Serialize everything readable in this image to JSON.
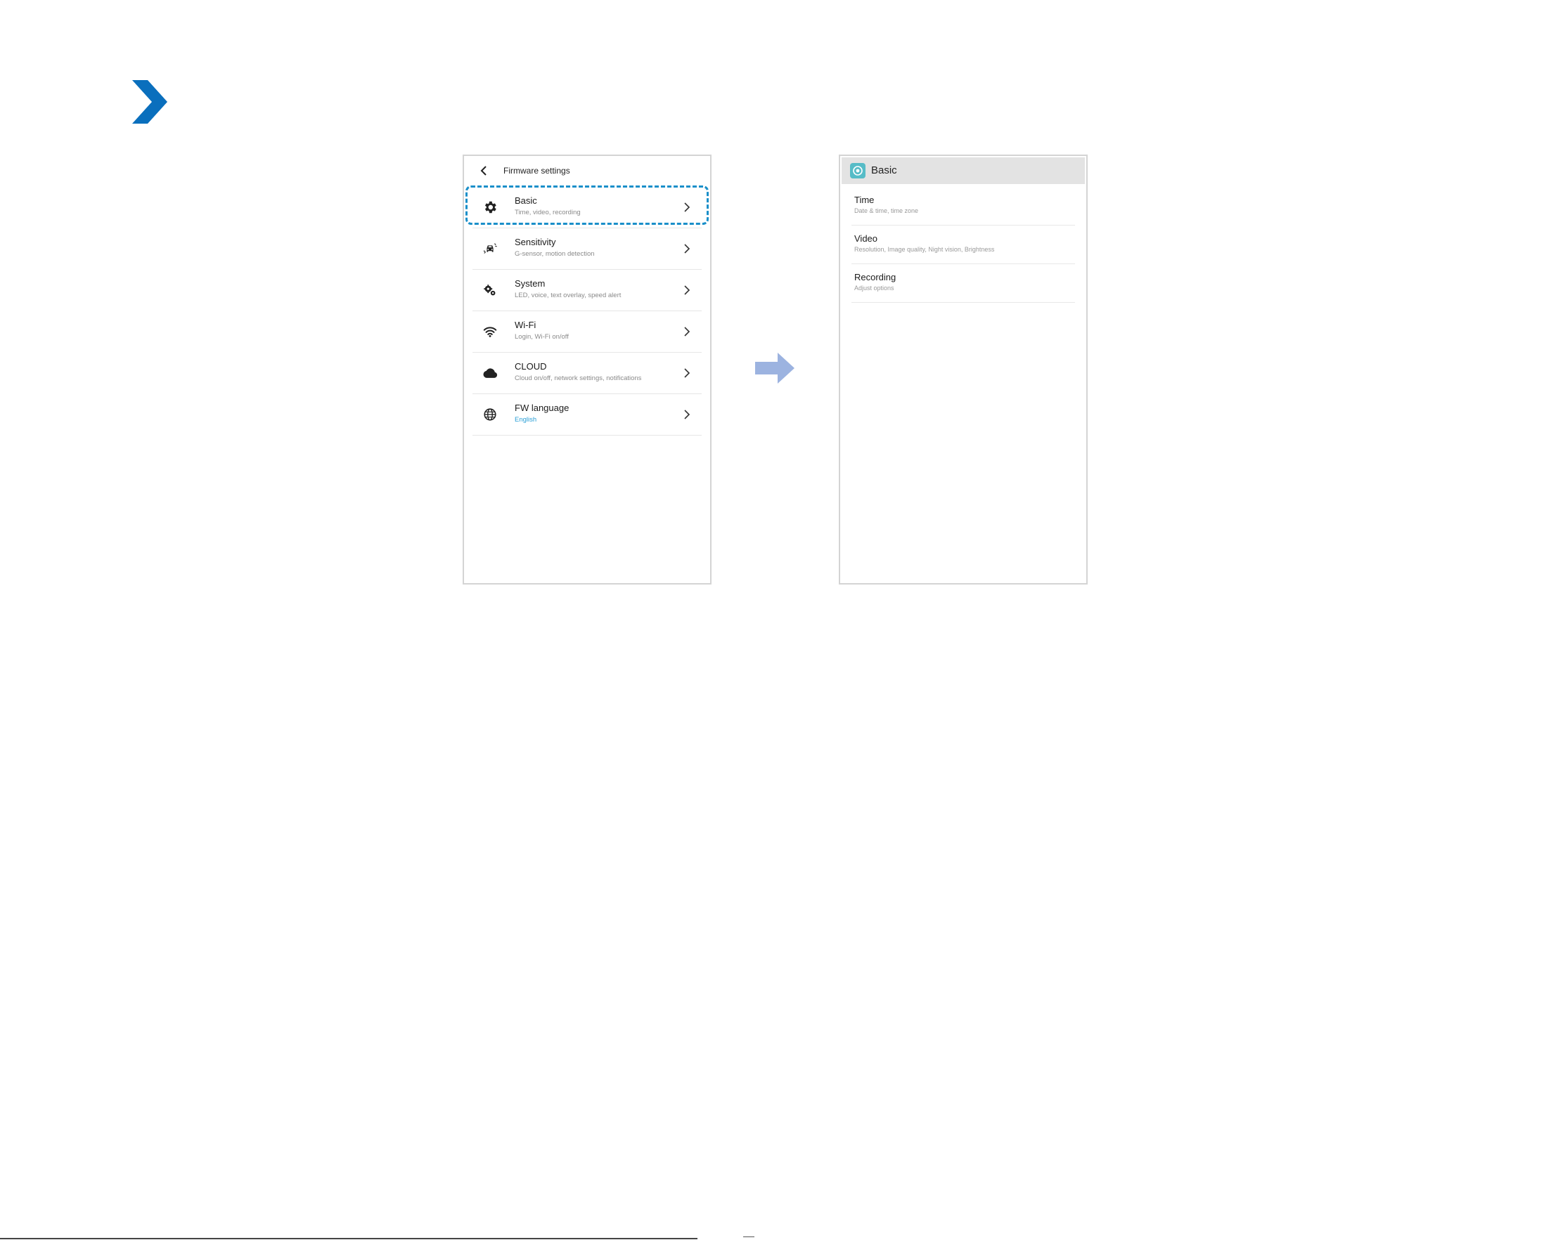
{
  "colors": {
    "brand_blue": "#0a6fbd",
    "highlight": "#1a8fc9",
    "arrow": "#9cb3e0",
    "accent_text": "#2a9fd6",
    "app_icon": "#56bcc7"
  },
  "firmware_screen": {
    "title": "Firmware settings",
    "back_icon": "chevron-left-icon",
    "items": [
      {
        "title": "Basic",
        "subtitle": "Time, video, recording",
        "icon": "gear-icon"
      },
      {
        "title": "Sensitivity",
        "subtitle": "G-sensor, motion detection",
        "icon": "car-impact-icon"
      },
      {
        "title": "System",
        "subtitle": "LED, voice, text overlay, speed alert",
        "icon": "gears-icon"
      },
      {
        "title": "Wi-Fi",
        "subtitle": "Login, Wi-Fi on/off",
        "icon": "wifi-icon"
      },
      {
        "title": "CLOUD",
        "subtitle": "Cloud on/off, network settings, notifications",
        "icon": "cloud-icon"
      },
      {
        "title": "FW language",
        "subtitle": "English",
        "icon": "globe-icon"
      }
    ]
  },
  "basic_screen": {
    "title": "Basic",
    "items": [
      {
        "title": "Time",
        "subtitle": "Date & time, time zone"
      },
      {
        "title": "Video",
        "subtitle": "Resolution, Image quality, Night vision, Brightness"
      },
      {
        "title": "Recording",
        "subtitle": "Adjust options"
      }
    ]
  }
}
